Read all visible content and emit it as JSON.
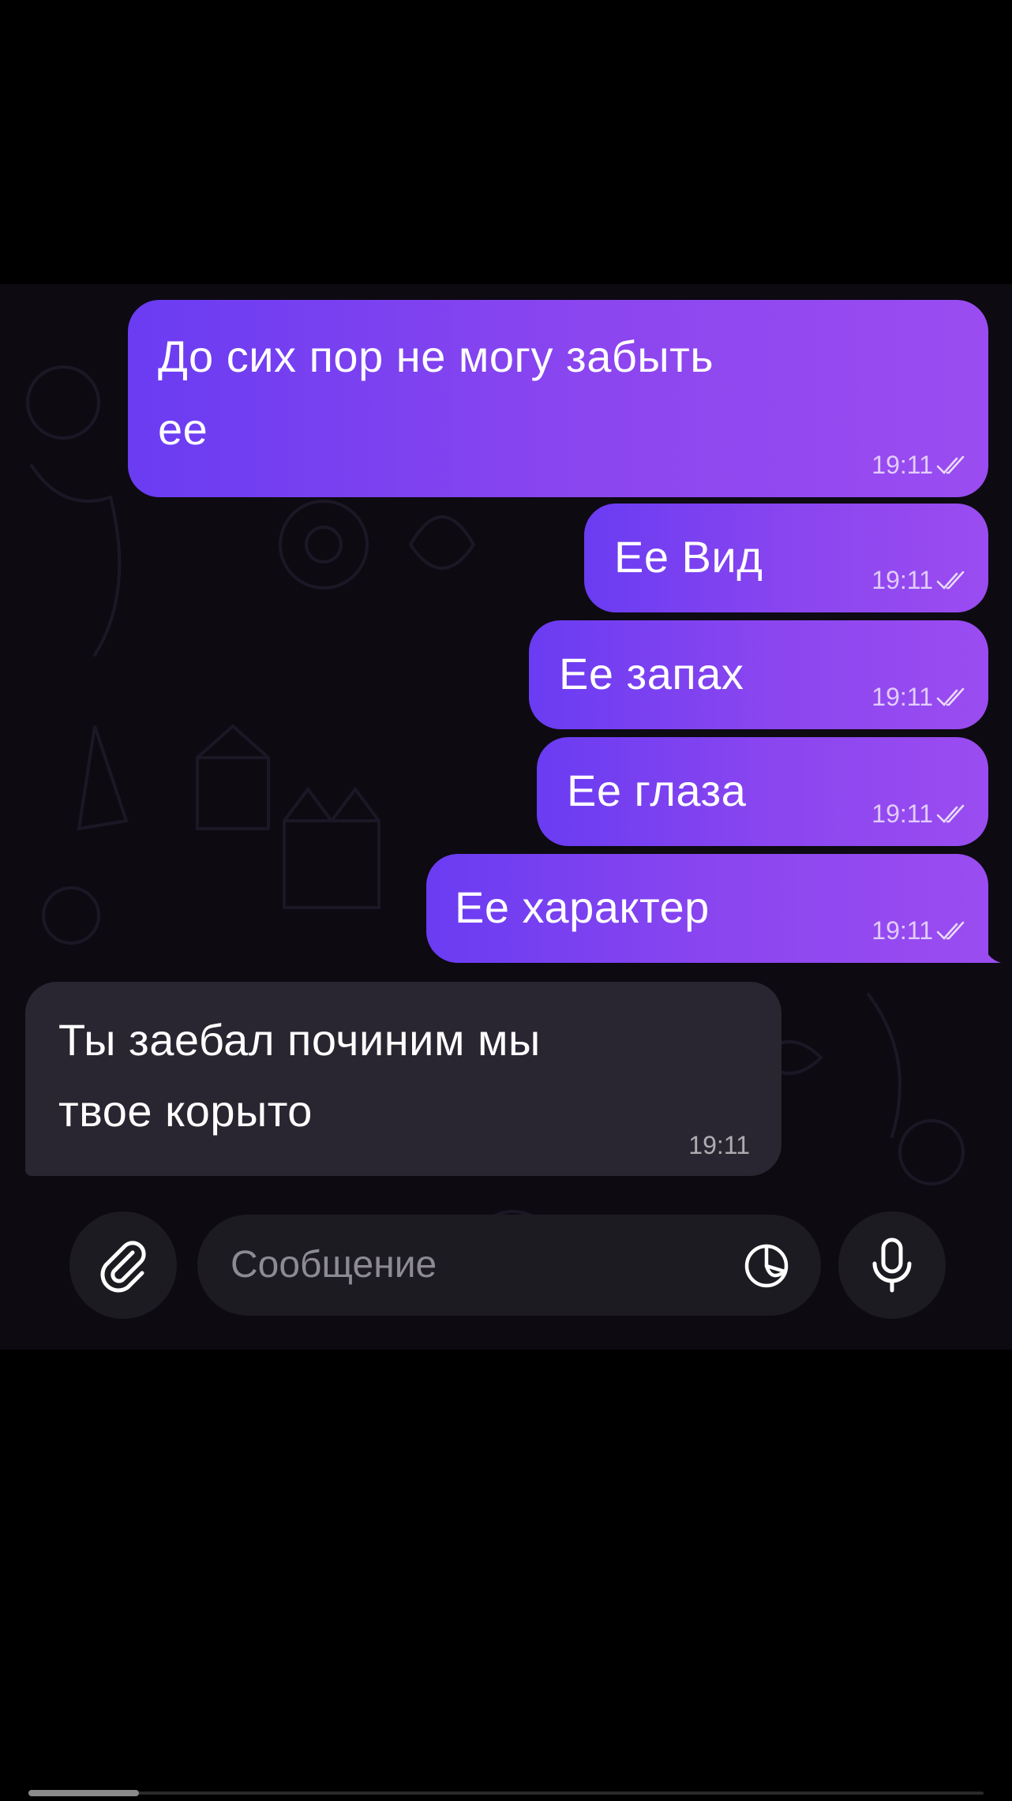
{
  "messages": [
    {
      "direction": "outgoing",
      "text_line1": "До сих пор не могу забыть",
      "text_line2": "ее",
      "time": "19:11",
      "status": "read"
    },
    {
      "direction": "outgoing",
      "text": "Ее Вид",
      "time": "19:11",
      "status": "read"
    },
    {
      "direction": "outgoing",
      "text": "Ее запах",
      "time": "19:11",
      "status": "read"
    },
    {
      "direction": "outgoing",
      "text": "Ее глаза",
      "time": "19:11",
      "status": "read"
    },
    {
      "direction": "outgoing",
      "text": "Ее характер",
      "time": "19:11",
      "status": "read"
    },
    {
      "direction": "incoming",
      "text_line1": "Ты заебал починим мы",
      "text_line2": "твое корыто",
      "time": "19:11"
    }
  ],
  "composer": {
    "placeholder": "Сообщение",
    "attach_icon": "paperclip-icon",
    "sticker_icon": "sticker-icon",
    "mic_icon": "microphone-icon"
  },
  "colors": {
    "outgoing_bubble": "#7a40f0",
    "incoming_bubble": "#2a2631",
    "background": "#000000"
  }
}
